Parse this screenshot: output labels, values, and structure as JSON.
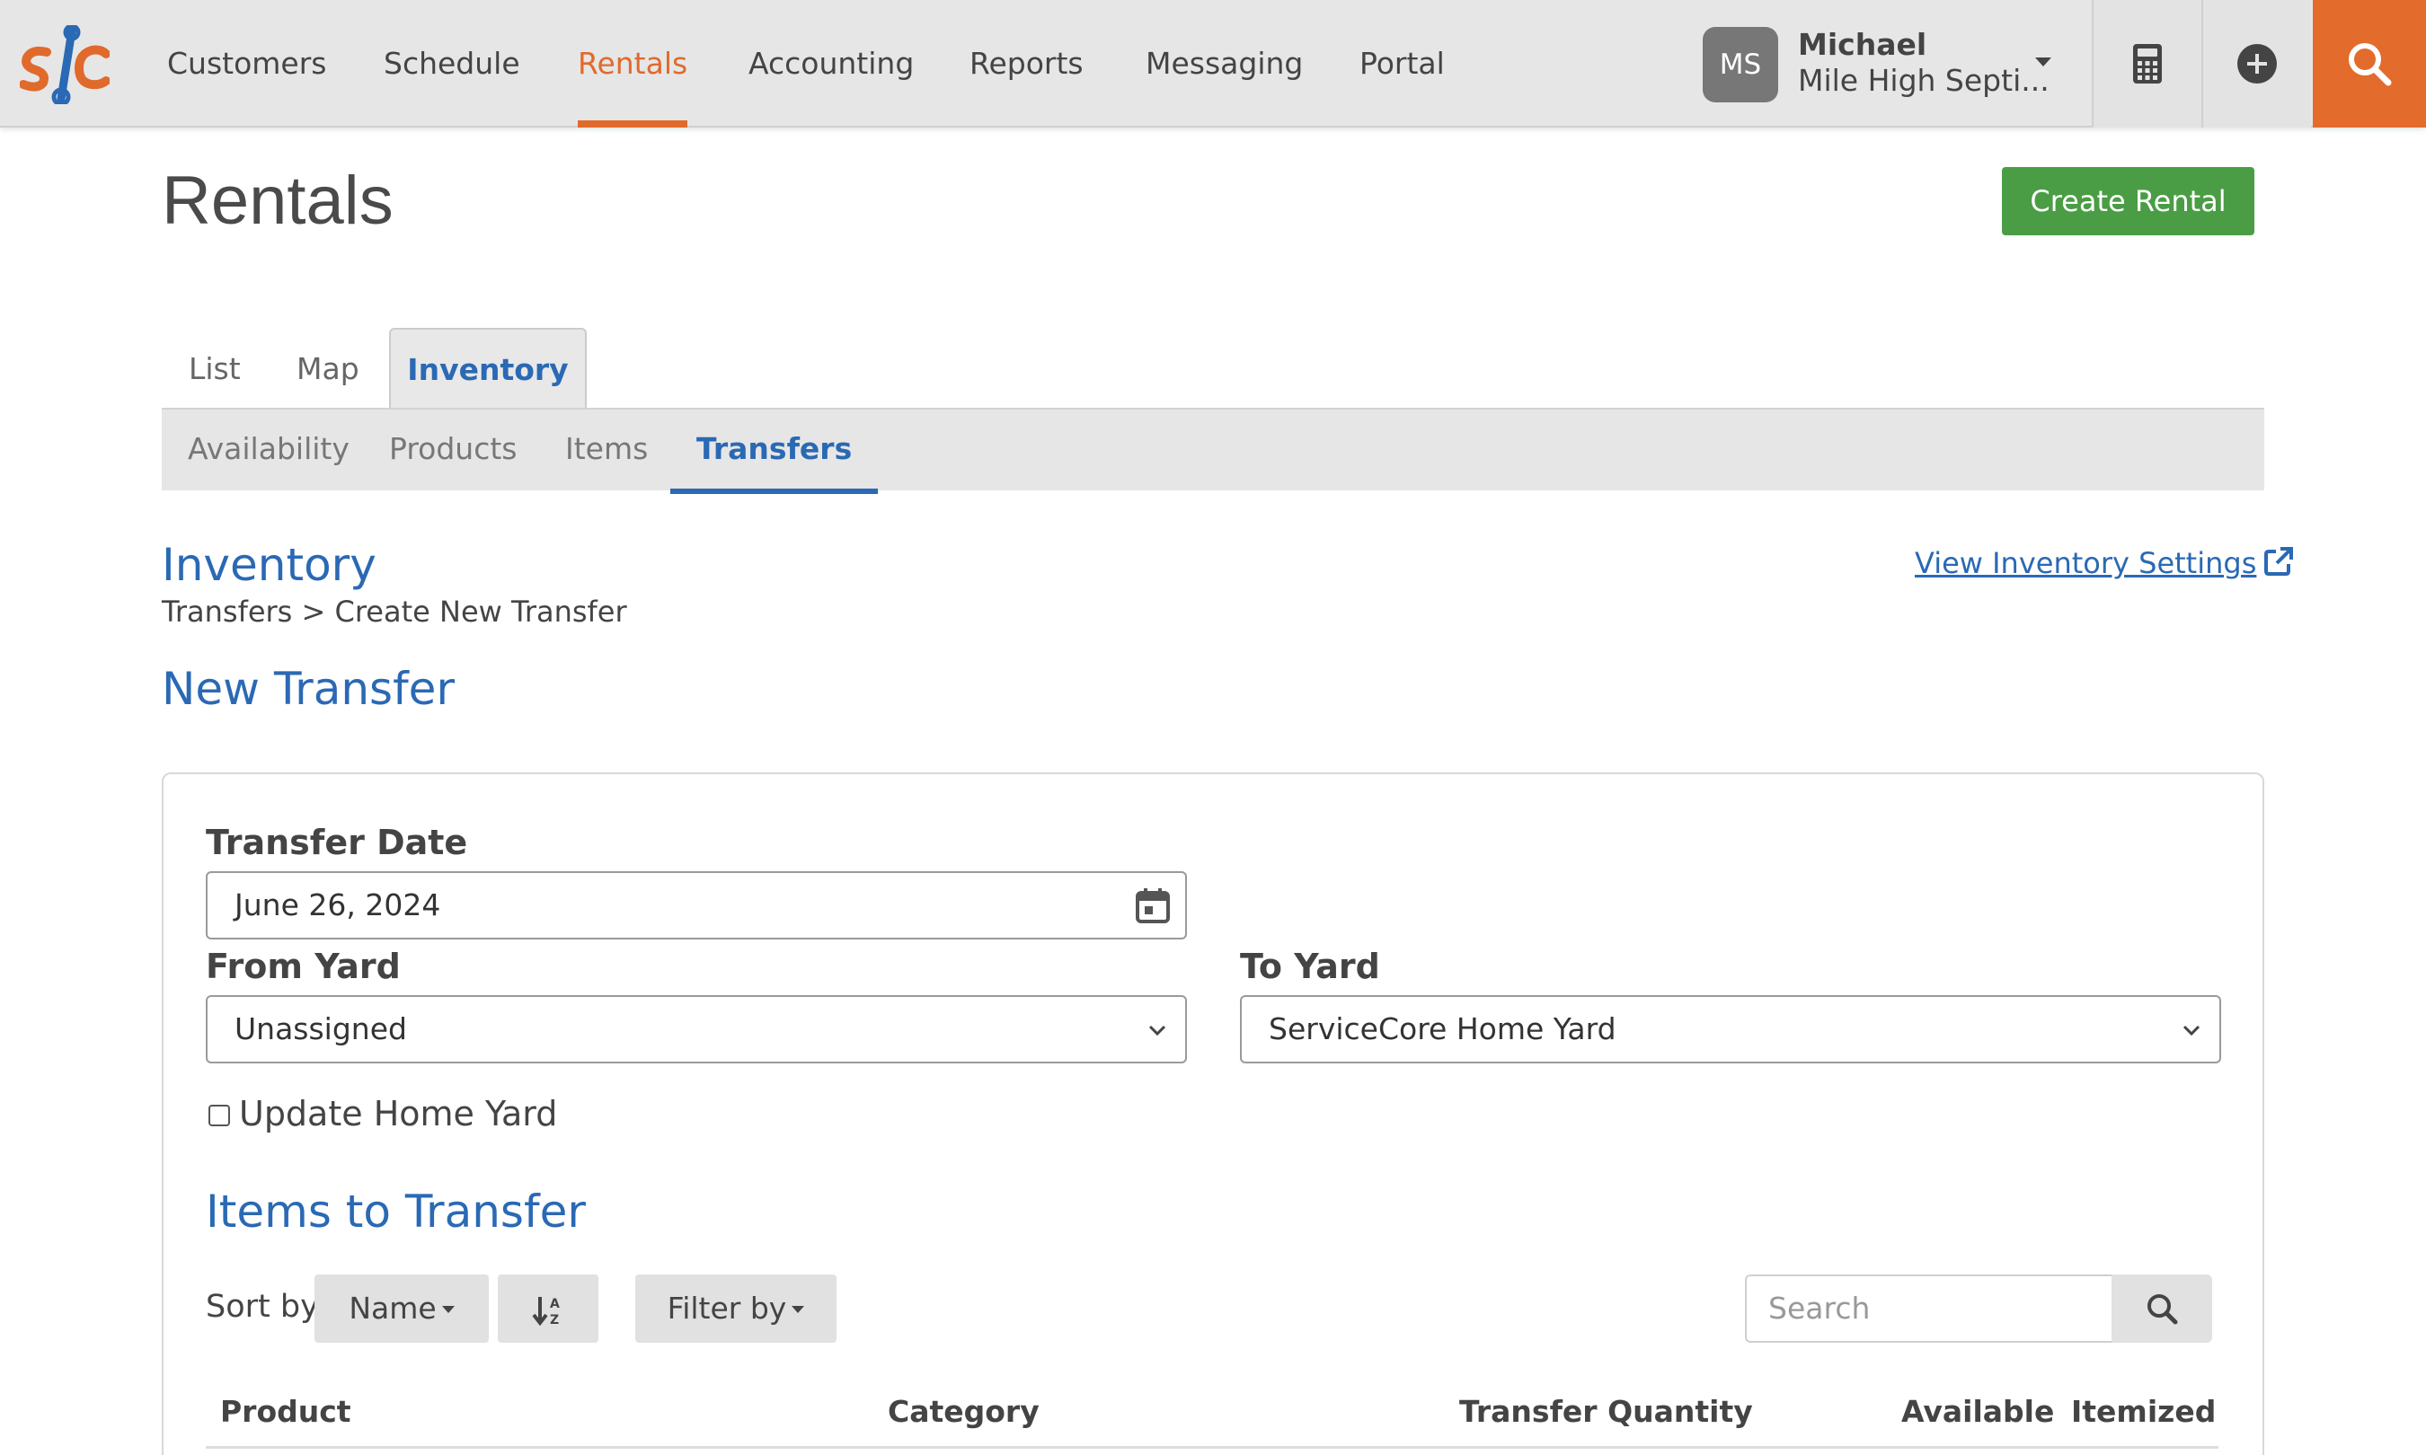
{
  "nav": {
    "logo_text": "s|c",
    "items": [
      {
        "label": "Customers",
        "active": false
      },
      {
        "label": "Schedule",
        "active": false
      },
      {
        "label": "Rentals",
        "active": true
      },
      {
        "label": "Accounting",
        "active": false
      },
      {
        "label": "Reports",
        "active": false
      },
      {
        "label": "Messaging",
        "active": false
      },
      {
        "label": "Portal",
        "active": false
      }
    ],
    "user": {
      "initials": "MS",
      "name": "Michael",
      "company": "Mile High Septi..."
    },
    "icons": [
      "calculator-icon",
      "plus-circle-icon",
      "search-icon"
    ],
    "accent_color": "#e36b2c"
  },
  "header": {
    "title": "Rentals",
    "create_button": "Create Rental"
  },
  "tabs": {
    "items": [
      "List",
      "Map",
      "Inventory"
    ],
    "active": "Inventory"
  },
  "subtabs": {
    "items": [
      "Availability",
      "Products",
      "Items",
      "Transfers"
    ],
    "active": "Transfers"
  },
  "section": {
    "title": "Inventory",
    "breadcrumb": "Transfers > Create New Transfer",
    "settings_link": "View Inventory Settings",
    "form_title": "New Transfer"
  },
  "form": {
    "transfer_date_label": "Transfer Date",
    "transfer_date_value": "June 26, 2024",
    "from_yard_label": "From Yard",
    "from_yard_value": "Unassigned",
    "to_yard_label": "To Yard",
    "to_yard_value": "ServiceCore Home Yard",
    "update_home_yard_label": "Update Home Yard",
    "update_home_yard_checked": false
  },
  "items_section": {
    "title": "Items to Transfer",
    "sort_label": "Sort by",
    "sort_value": "Name",
    "filter_label": "Filter by",
    "search_placeholder": "Search",
    "columns": [
      "Product",
      "Category",
      "Transfer Quantity",
      "Available",
      "Itemized"
    ]
  },
  "colors": {
    "primary_blue": "#2a69b4",
    "orange": "#e06a2c",
    "green": "#4a9d44"
  }
}
